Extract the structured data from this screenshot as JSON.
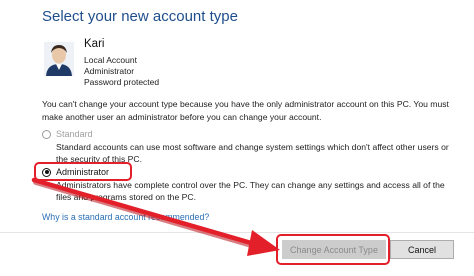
{
  "page": {
    "heading": "Select your new account type"
  },
  "user": {
    "name": "Kari",
    "lines": [
      "Local Account",
      "Administrator",
      "Password protected"
    ]
  },
  "notice": "You can't change your account type because you have the only administrator account on this PC. You must make another user an administrator before you can change your account.",
  "options": {
    "standard": {
      "label": "Standard",
      "description": "Standard accounts can use most software and change system settings which don't affect other users or the security of this PC.",
      "selected": false,
      "disabled": true
    },
    "administrator": {
      "label": "Administrator",
      "description": "Administrators have complete control over the PC. They can change any settings and access all of the files and programs stored on the PC.",
      "selected": true,
      "disabled": false
    }
  },
  "help_link": "Why is a standard account recommended?",
  "buttons": {
    "change_label": "Change Account Type",
    "cancel_label": "Cancel"
  },
  "icons": {
    "avatar": "user-avatar-icon",
    "arrow": "red-arrow-annotation"
  },
  "colors": {
    "heading": "#1f4e8c",
    "link": "#2a6fb6",
    "annotation": "#e3202a",
    "disabled_button": "#cccccc"
  }
}
